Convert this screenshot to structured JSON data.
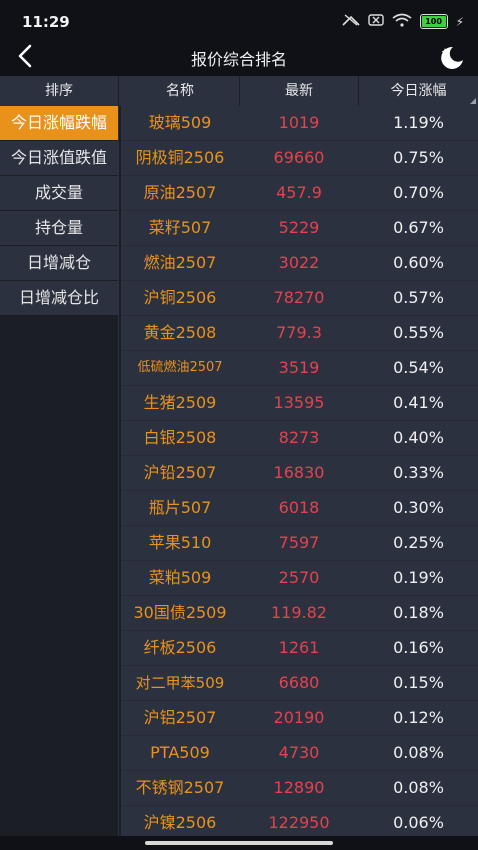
{
  "status": {
    "time": "11:29",
    "battery": "100"
  },
  "header": {
    "title": "报价综合排名"
  },
  "columns": {
    "sort": "排序",
    "name": "名称",
    "latest": "最新",
    "change": "今日涨幅"
  },
  "sidebar": {
    "items": [
      {
        "label": "今日涨幅跌幅",
        "active": true
      },
      {
        "label": "今日涨值跌值"
      },
      {
        "label": "成交量"
      },
      {
        "label": "持仓量"
      },
      {
        "label": "日增减仓"
      },
      {
        "label": "日增减仓比"
      }
    ]
  },
  "rows": [
    {
      "name": "玻璃509",
      "latest": "1019",
      "change": "1.19%"
    },
    {
      "name": "阴极铜2506",
      "latest": "69660",
      "change": "0.75%"
    },
    {
      "name": "原油2507",
      "latest": "457.9",
      "change": "0.70%"
    },
    {
      "name": "菜籽507",
      "latest": "5229",
      "change": "0.67%"
    },
    {
      "name": "燃油2507",
      "latest": "3022",
      "change": "0.60%"
    },
    {
      "name": "沪铜2506",
      "latest": "78270",
      "change": "0.57%"
    },
    {
      "name": "黄金2508",
      "latest": "779.3",
      "change": "0.55%"
    },
    {
      "name": "低硫燃油2507",
      "latest": "3519",
      "change": "0.54%"
    },
    {
      "name": "生猪2509",
      "latest": "13595",
      "change": "0.41%"
    },
    {
      "name": "白银2508",
      "latest": "8273",
      "change": "0.40%"
    },
    {
      "name": "沪铅2507",
      "latest": "16830",
      "change": "0.33%"
    },
    {
      "name": "瓶片507",
      "latest": "6018",
      "change": "0.30%"
    },
    {
      "name": "苹果510",
      "latest": "7597",
      "change": "0.25%"
    },
    {
      "name": "菜粕509",
      "latest": "2570",
      "change": "0.19%"
    },
    {
      "name": "30国债2509",
      "latest": "119.82",
      "change": "0.18%"
    },
    {
      "name": "纤板2506",
      "latest": "1261",
      "change": "0.16%"
    },
    {
      "name": "对二甲苯509",
      "latest": "6680",
      "change": "0.15%"
    },
    {
      "name": "沪铝2507",
      "latest": "20190",
      "change": "0.12%"
    },
    {
      "name": "PTA509",
      "latest": "4730",
      "change": "0.08%"
    },
    {
      "name": "不锈钢2507",
      "latest": "12890",
      "change": "0.08%"
    },
    {
      "name": "沪镍2506",
      "latest": "122950",
      "change": "0.06%"
    }
  ]
}
